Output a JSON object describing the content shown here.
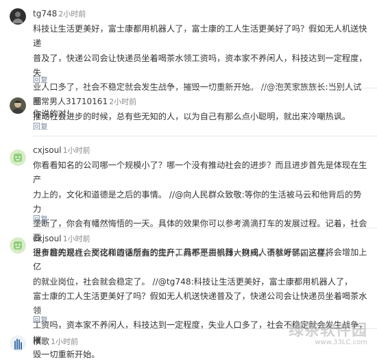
{
  "comments": [
    {
      "username": "tg748",
      "time": "2小时前",
      "lines": [
        "科技让生活更美好，富士康都用机器人了，富士康的工人生活更美好了吗？假如无人机送快递",
        "普及了，快递公司会让快递员坐着喝茶水领工资吗，资本家不养闲人，科技达到一定程度，失",
        "业人口多了，社会不稳定就会发生战争，摧毁一切重新开始。 //@泡芙家族族长:当别人试图",
        "推动社会进步的时候，总有些无知的人，以为自己有那么点小聪明，就出来冷嘲热讽。"
      ],
      "reply": "回复"
    },
    {
      "username": "非常男人31710161",
      "time": "2小时前",
      "lines": [
        "你说的对！"
      ],
      "reply": "回复"
    },
    {
      "username": "cxjsoul",
      "time": "1小时前",
      "lines": [
        "你看看知名的公司哪一个规模小了？哪一个没有推动社会的进步？而且进步首先是体现在生产",
        "力上的，文化和道德是之后的事情。 //@向人民群众致敬:等你的生活被马云和他背后的势力",
        "垄断了，你会有幡然悔悟的一天。具体的效果你可以参考滴滴打车的发展过程。记着，社会要",
        "进步首先是社会文化和道德层面的提升，而不是去崇拜大财阀。请参考韩国三星。"
      ],
      "reply": "回复"
    },
    {
      "username": "cxjsoul",
      "time": "1小时前",
      "lines": [
        "很有趣的观点，那这样的话所有的生产工具都不用机器，换成人不就好了，这样将会增加上亿",
        "的就业岗位，社会就会稳定了。 //@tg748:科技让生活更美好，富士康都用机器人了，",
        "富士康的工人生活更美好了吗？假如无人机送快递普及了，快递公司会让快递员坐着喝茶水领",
        "工资吗，资本家不养闲人，科技达到一定程度，失业人口多了，社会不稳定就会发生战争，摧",
        "毁一切重新开始。"
      ],
      "reply": "回复"
    },
    {
      "username": "棋歌",
      "time": "1小时前",
      "lines": [],
      "reply": ""
    }
  ],
  "watermark": {
    "main": "绿茶软件园",
    "sub": "www.33LC.com"
  },
  "colors": {
    "divider": "#e8e8e8",
    "reply": "#7a8aa0",
    "avatar_green": "#8fcf79"
  }
}
